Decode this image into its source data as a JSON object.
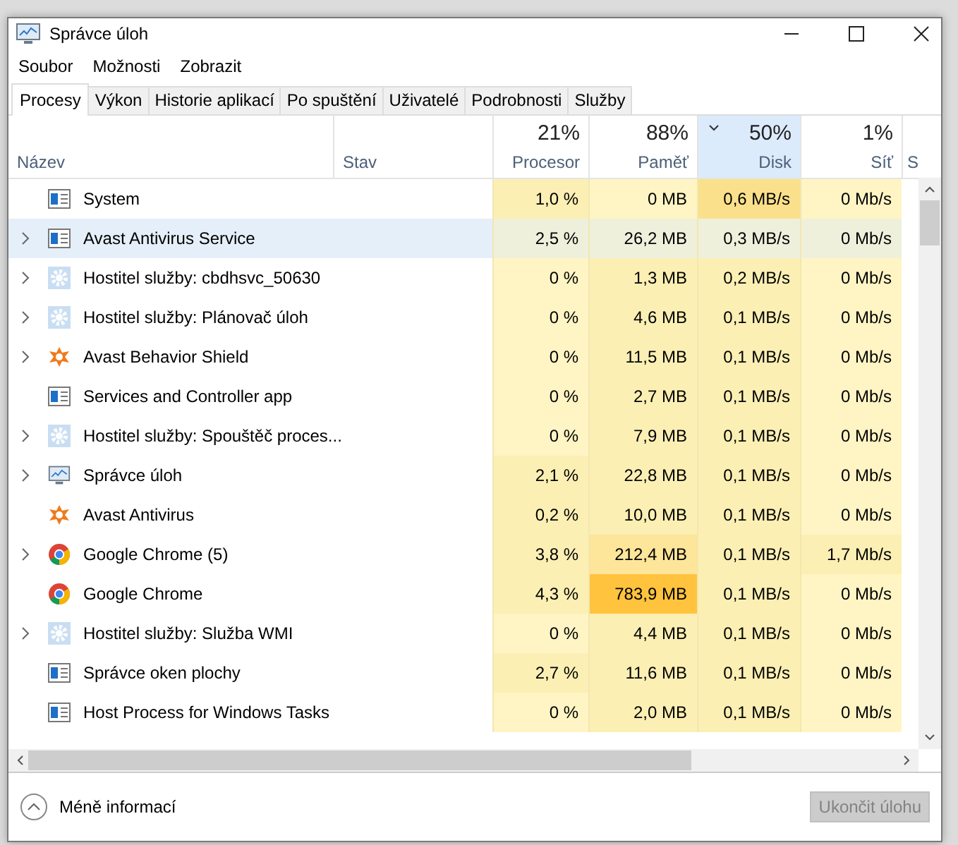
{
  "window": {
    "title": "Správce úloh"
  },
  "menu": [
    "Soubor",
    "Možnosti",
    "Zobrazit"
  ],
  "tabs": [
    {
      "label": "Procesy",
      "selected": true
    },
    {
      "label": "Výkon",
      "selected": false
    },
    {
      "label": "Historie aplikací",
      "selected": false
    },
    {
      "label": "Po spuštění",
      "selected": false
    },
    {
      "label": "Uživatelé",
      "selected": false
    },
    {
      "label": "Podrobnosti",
      "selected": false
    },
    {
      "label": "Služby",
      "selected": false
    }
  ],
  "columns": [
    {
      "label": "Název",
      "sorted": false
    },
    {
      "label": "Stav",
      "sorted": false
    },
    {
      "label": "Procesor",
      "percent": "21%",
      "sorted": false
    },
    {
      "label": "Paměť",
      "percent": "88%",
      "sorted": false
    },
    {
      "label": "Disk",
      "percent": "50%",
      "sorted": true
    },
    {
      "label": "Síť",
      "percent": "1%",
      "sorted": false
    },
    {
      "label": "S",
      "sorted": false
    }
  ],
  "rows": [
    {
      "name": "System",
      "kind": "window",
      "expandable": false,
      "selected": false,
      "cells": [
        {
          "text": "1,0 %",
          "color": "#fcefb4"
        },
        {
          "text": "0 MB",
          "color": "#fff4c4"
        },
        {
          "text": "0,6 MB/s",
          "color": "#fbe08c"
        },
        {
          "text": "0 Mb/s",
          "color": "#fff4c4"
        }
      ]
    },
    {
      "name": "Avast Antivirus  Service",
      "kind": "window",
      "expandable": true,
      "selected": true,
      "cells": [
        {
          "text": "2,5 %",
          "color": "#eef0dc"
        },
        {
          "text": "26,2 MB",
          "color": "#eef0dc"
        },
        {
          "text": "0,3 MB/s",
          "color": "#eef0dc"
        },
        {
          "text": "0 Mb/s",
          "color": "#eef0dc"
        }
      ]
    },
    {
      "name": "Hostitel služby: cbdhsvc_50630",
      "kind": "gear",
      "expandable": true,
      "selected": false,
      "cells": [
        {
          "text": "0 %",
          "color": "#fff4c4"
        },
        {
          "text": "1,3 MB",
          "color": "#fcefb4"
        },
        {
          "text": "0,2 MB/s",
          "color": "#fcefb4"
        },
        {
          "text": "0 Mb/s",
          "color": "#fff4c4"
        }
      ]
    },
    {
      "name": "Hostitel služby: Plánovač úloh",
      "kind": "gear",
      "expandable": true,
      "selected": false,
      "cells": [
        {
          "text": "0 %",
          "color": "#fff4c4"
        },
        {
          "text": "4,6 MB",
          "color": "#fcefb4"
        },
        {
          "text": "0,1 MB/s",
          "color": "#fcefb4"
        },
        {
          "text": "0 Mb/s",
          "color": "#fff4c4"
        }
      ]
    },
    {
      "name": "Avast Behavior Shield",
      "kind": "avast",
      "expandable": true,
      "selected": false,
      "cells": [
        {
          "text": "0 %",
          "color": "#fff4c4"
        },
        {
          "text": "11,5 MB",
          "color": "#fcefb4"
        },
        {
          "text": "0,1 MB/s",
          "color": "#fcefb4"
        },
        {
          "text": "0 Mb/s",
          "color": "#fff4c4"
        }
      ]
    },
    {
      "name": "Services and Controller app",
      "kind": "window",
      "expandable": false,
      "selected": false,
      "cells": [
        {
          "text": "0 %",
          "color": "#fff4c4"
        },
        {
          "text": "2,7 MB",
          "color": "#fcefb4"
        },
        {
          "text": "0,1 MB/s",
          "color": "#fcefb4"
        },
        {
          "text": "0 Mb/s",
          "color": "#fff4c4"
        }
      ]
    },
    {
      "name": "Hostitel služby: Spouštěč proces...",
      "kind": "gear",
      "expandable": true,
      "selected": false,
      "cells": [
        {
          "text": "0 %",
          "color": "#fff4c4"
        },
        {
          "text": "7,9 MB",
          "color": "#fcefb4"
        },
        {
          "text": "0,1 MB/s",
          "color": "#fcefb4"
        },
        {
          "text": "0 Mb/s",
          "color": "#fff4c4"
        }
      ]
    },
    {
      "name": "Správce úloh",
      "kind": "monitor",
      "expandable": true,
      "selected": false,
      "cells": [
        {
          "text": "2,1 %",
          "color": "#fcefb4"
        },
        {
          "text": "22,8 MB",
          "color": "#fcefb4"
        },
        {
          "text": "0,1 MB/s",
          "color": "#fcefb4"
        },
        {
          "text": "0 Mb/s",
          "color": "#fff4c4"
        }
      ]
    },
    {
      "name": "Avast Antivirus",
      "kind": "avast",
      "expandable": false,
      "selected": false,
      "cells": [
        {
          "text": "0,2 %",
          "color": "#fcefb4"
        },
        {
          "text": "10,0 MB",
          "color": "#fcefb4"
        },
        {
          "text": "0,1 MB/s",
          "color": "#fcefb4"
        },
        {
          "text": "0 Mb/s",
          "color": "#fff4c4"
        }
      ]
    },
    {
      "name": "Google Chrome (5)",
      "kind": "chrome",
      "expandable": true,
      "selected": false,
      "cells": [
        {
          "text": "3,8 %",
          "color": "#fcefb4"
        },
        {
          "text": "212,4 MB",
          "color": "#fde599"
        },
        {
          "text": "0,1 MB/s",
          "color": "#fcefb4"
        },
        {
          "text": "1,7 Mb/s",
          "color": "#fcefb4"
        }
      ]
    },
    {
      "name": "Google Chrome",
      "kind": "chrome",
      "expandable": false,
      "selected": false,
      "cells": [
        {
          "text": "4,3 %",
          "color": "#fcefb4"
        },
        {
          "text": "783,9 MB",
          "color": "#ffc33e"
        },
        {
          "text": "0,1 MB/s",
          "color": "#fcefb4"
        },
        {
          "text": "0 Mb/s",
          "color": "#fff4c4"
        }
      ]
    },
    {
      "name": "Hostitel služby: Služba WMI",
      "kind": "gear",
      "expandable": true,
      "selected": false,
      "cells": [
        {
          "text": "0 %",
          "color": "#fff4c4"
        },
        {
          "text": "4,4 MB",
          "color": "#fcefb4"
        },
        {
          "text": "0,1 MB/s",
          "color": "#fcefb4"
        },
        {
          "text": "0 Mb/s",
          "color": "#fff4c4"
        }
      ]
    },
    {
      "name": "Správce oken plochy",
      "kind": "window",
      "expandable": false,
      "selected": false,
      "cells": [
        {
          "text": "2,7 %",
          "color": "#fcefb4"
        },
        {
          "text": "11,6 MB",
          "color": "#fcefb4"
        },
        {
          "text": "0,1 MB/s",
          "color": "#fcefb4"
        },
        {
          "text": "0 Mb/s",
          "color": "#fff4c4"
        }
      ]
    },
    {
      "name": "Host Process for Windows Tasks",
      "kind": "window",
      "expandable": false,
      "selected": false,
      "cells": [
        {
          "text": "0 %",
          "color": "#fff4c4"
        },
        {
          "text": "2,0 MB",
          "color": "#fcefb4"
        },
        {
          "text": "0,1 MB/s",
          "color": "#fcefb4"
        },
        {
          "text": "0 Mb/s",
          "color": "#fff4c4"
        }
      ]
    }
  ],
  "footer": {
    "toggle": "Méně informací",
    "end_task": {
      "label": "Ukončit úlohu",
      "disabled": true
    }
  }
}
